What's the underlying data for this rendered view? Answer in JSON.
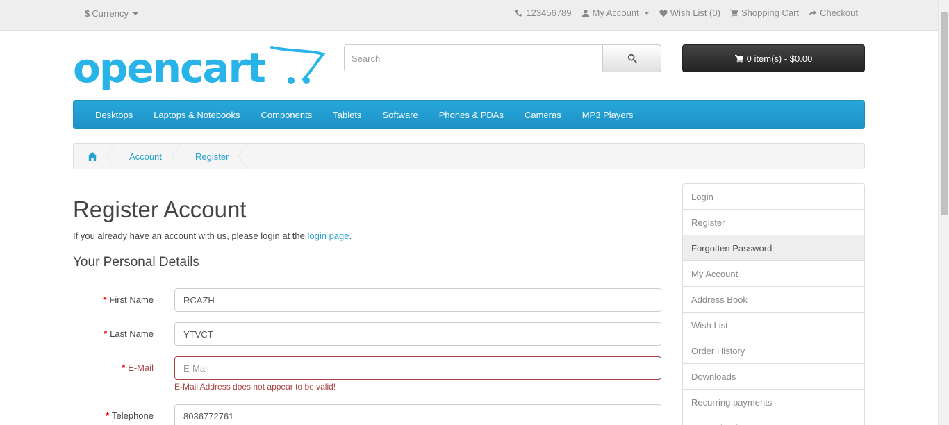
{
  "topbar": {
    "currency_symbol": "$",
    "currency_label": "Currency",
    "phone": "123456789",
    "my_account": "My Account",
    "wish_list": "Wish List (0)",
    "shopping_cart": "Shopping Cart",
    "checkout": "Checkout"
  },
  "header": {
    "logo_text": "opencart",
    "search_placeholder": "Search",
    "cart_label": "0 item(s) - $0.00",
    "brand_color": "#28b4e8"
  },
  "menu": {
    "items": [
      "Desktops",
      "Laptops & Notebooks",
      "Components",
      "Tablets",
      "Software",
      "Phones & PDAs",
      "Cameras",
      "MP3 Players"
    ]
  },
  "breadcrumb": {
    "items": [
      "Account",
      "Register"
    ]
  },
  "main": {
    "title": "Register Account",
    "intro_text": "If you already have an account with us, please login at the ",
    "intro_link": "login page",
    "intro_end": ".",
    "section_title": "Your Personal Details",
    "fields": [
      {
        "label": "First Name",
        "value": "RCAZH",
        "placeholder": "First Name"
      },
      {
        "label": "Last Name",
        "value": "YTVCT",
        "placeholder": "Last Name"
      },
      {
        "label": "E-Mail",
        "value": "",
        "placeholder": "E-Mail",
        "error": "E-Mail Address does not appear to be valid!"
      },
      {
        "label": "Telephone",
        "value": "8036772761",
        "placeholder": "Telephone"
      }
    ]
  },
  "sidebar": {
    "items": [
      "Login",
      "Register",
      "Forgotten Password",
      "My Account",
      "Address Book",
      "Wish List",
      "Order History",
      "Downloads",
      "Recurring payments",
      "Reward Points"
    ],
    "active_index": 2
  }
}
